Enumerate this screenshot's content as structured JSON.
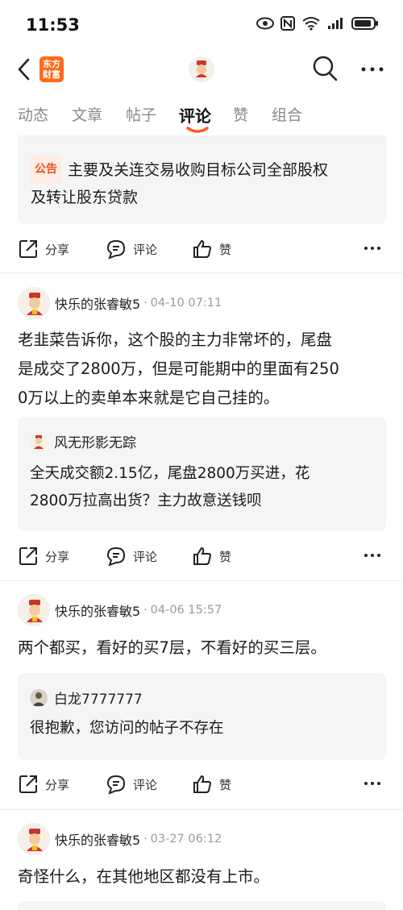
{
  "status_bar": {
    "time": "11:53",
    "battery_icon": "battery-icon",
    "signal_icon": "signal-icon",
    "wifi_icon": "wifi-icon",
    "nfc_icon": "nfc-icon",
    "eye_icon": "eye-icon"
  },
  "header": {
    "logo_text_line1": "东方",
    "logo_text_line2": "财富"
  },
  "tabs": [
    {
      "label": "动态",
      "active": false
    },
    {
      "label": "文章",
      "active": false
    },
    {
      "label": "帖子",
      "active": false
    },
    {
      "label": "评论",
      "active": true
    },
    {
      "label": "赞",
      "active": false
    },
    {
      "label": "组合",
      "active": false
    }
  ],
  "colors": {
    "accent": "#ff6a1a",
    "tab_underline": "#ff5a1f",
    "notice_bg": "#ffece3",
    "notice_text": "#e8521b"
  },
  "actions": {
    "share": "分享",
    "comment": "评论",
    "like": "赞"
  },
  "posts": [
    {
      "quote": {
        "badge": "公告",
        "text_line1": "主要及关连交易收购目标公司全部股权",
        "text_line2": "及转让股东贷款"
      }
    },
    {
      "author": "快乐的张睿敏5",
      "time": "04-10 07:11",
      "text_line1": "老韭菜告诉你，这个股的主力非常坏的，尾盘",
      "text_line2": "是成交了2800万，但是可能期中的里面有250",
      "text_line3": "0万以上的卖单本来就是它自己挂的。",
      "quote": {
        "author": "风无形影无踪",
        "text_line1": "全天成交额2.15亿，尾盘2800万买进，花",
        "text_line2": "2800万拉高出货？主力故意送钱呗"
      }
    },
    {
      "author": "快乐的张睿敏5",
      "time": "04-06 15:57",
      "text_line1": "两个都买，看好的买7层，不看好的买三层。",
      "quote": {
        "author": "白龙7777777",
        "text_line1": "很抱歉，您访问的帖子不存在"
      }
    },
    {
      "author": "快乐的张睿敏5",
      "time": "03-27 06:12",
      "text_line1": "奇怪什么，在其他地区都没有上市。"
    }
  ]
}
